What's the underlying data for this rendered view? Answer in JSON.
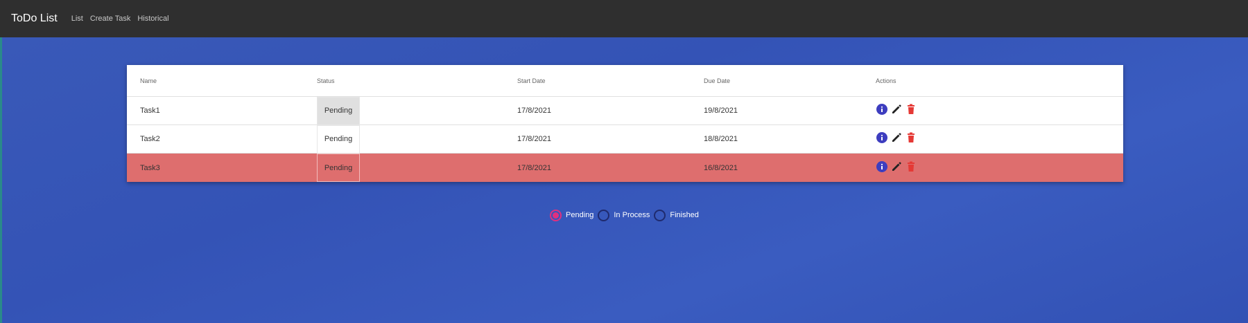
{
  "navbar": {
    "brand": "ToDo List",
    "links": [
      "List",
      "Create Task",
      "Historical"
    ]
  },
  "table": {
    "headers": {
      "name": "Name",
      "status": "Status",
      "start": "Start Date",
      "due": "Due Date",
      "actions": "Actions"
    },
    "rows": [
      {
        "name": "Task1",
        "status": "Pending",
        "start": "17/8/2021",
        "due": "19/8/2021",
        "highlight": false
      },
      {
        "name": "Task2",
        "status": "Pending",
        "start": "17/8/2021",
        "due": "18/8/2021",
        "highlight": false
      },
      {
        "name": "Task3",
        "status": "Pending",
        "start": "17/8/2021",
        "due": "16/8/2021",
        "highlight": true
      }
    ],
    "overdue_color": "#de6e6e",
    "icons": [
      "info-icon",
      "edit-icon",
      "delete-icon"
    ]
  },
  "filter": {
    "options": [
      "Pending",
      "In Process",
      "Finished"
    ],
    "selected": "Pending"
  },
  "colors": {
    "navbar": "#2f2f2f",
    "info": "#3d3dbf",
    "delete": "#e53935",
    "radio_checked": "#e0307f"
  }
}
